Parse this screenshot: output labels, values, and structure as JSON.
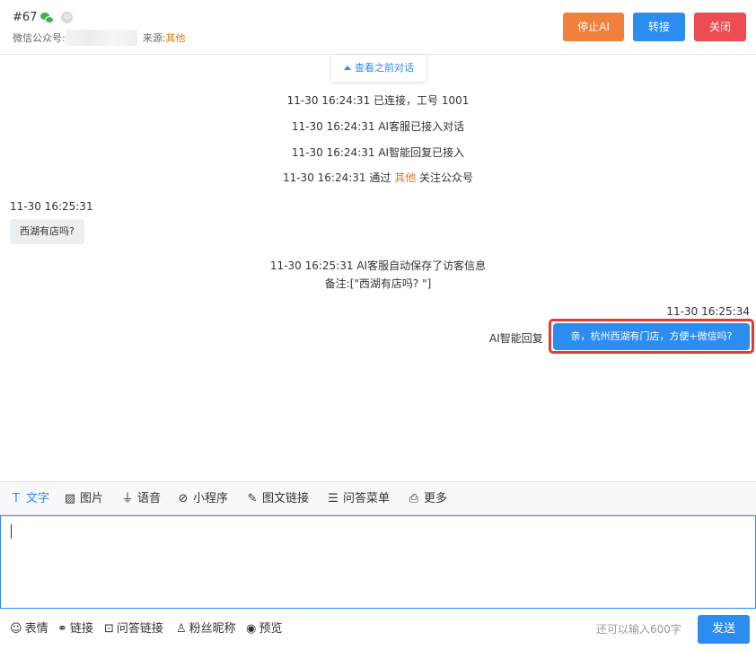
{
  "header": {
    "conversation_id": "#67",
    "id_badge": "ID",
    "account_label": "微信公众号:",
    "source_label": "来源:",
    "source_value": "其他",
    "buttons": {
      "stop_ai": "停止AI",
      "transfer": "转接",
      "close": "关闭"
    }
  },
  "chat": {
    "view_previous": "查看之前对话",
    "system_messages": [
      "11-30 16:24:31 已连接，工号 1001",
      "11-30 16:24:31 AI客服已接入对话",
      "11-30 16:24:31 AI智能回复已接入"
    ],
    "follow_message": {
      "prefix": "11-30 16:24:31 通过",
      "highlight": "其他",
      "suffix": "关注公众号"
    },
    "visitor_time": "11-30 16:25:31",
    "visitor_text": "西湖有店吗?",
    "save_message": {
      "line1": "11-30 16:25:31 AI客服自动保存了访客信息",
      "line2": "备注:[\"西湖有店吗? \"]"
    },
    "agent_time": "11-30 16:25:34",
    "agent_label": "AI智能回复",
    "agent_text": "亲，杭州西湖有门店，方便+微信吗?"
  },
  "toolbar": {
    "items": [
      {
        "icon": "text-icon",
        "label": "文字"
      },
      {
        "icon": "image-icon",
        "label": "图片"
      },
      {
        "icon": "mic-icon",
        "label": "语音"
      },
      {
        "icon": "mini-program-icon",
        "label": "小程序"
      },
      {
        "icon": "article-link-icon",
        "label": "图文链接"
      },
      {
        "icon": "list-icon",
        "label": "问答菜单"
      },
      {
        "icon": "more-icon",
        "label": "更多"
      }
    ]
  },
  "footer": {
    "items": [
      {
        "icon": "emoji-icon",
        "label": "表情"
      },
      {
        "icon": "link-icon",
        "label": "链接"
      },
      {
        "icon": "qa-link-icon",
        "label": "问答链接"
      },
      {
        "icon": "user-icon",
        "label": "粉丝昵称"
      },
      {
        "icon": "eye-icon",
        "label": "预览"
      }
    ],
    "remaining": "还可以输入600字",
    "send": "发送"
  },
  "colors": {
    "primary": "#2d8cf0",
    "orange": "#f0803b",
    "red": "#ed4d52",
    "highlight": "#e07b1a"
  }
}
